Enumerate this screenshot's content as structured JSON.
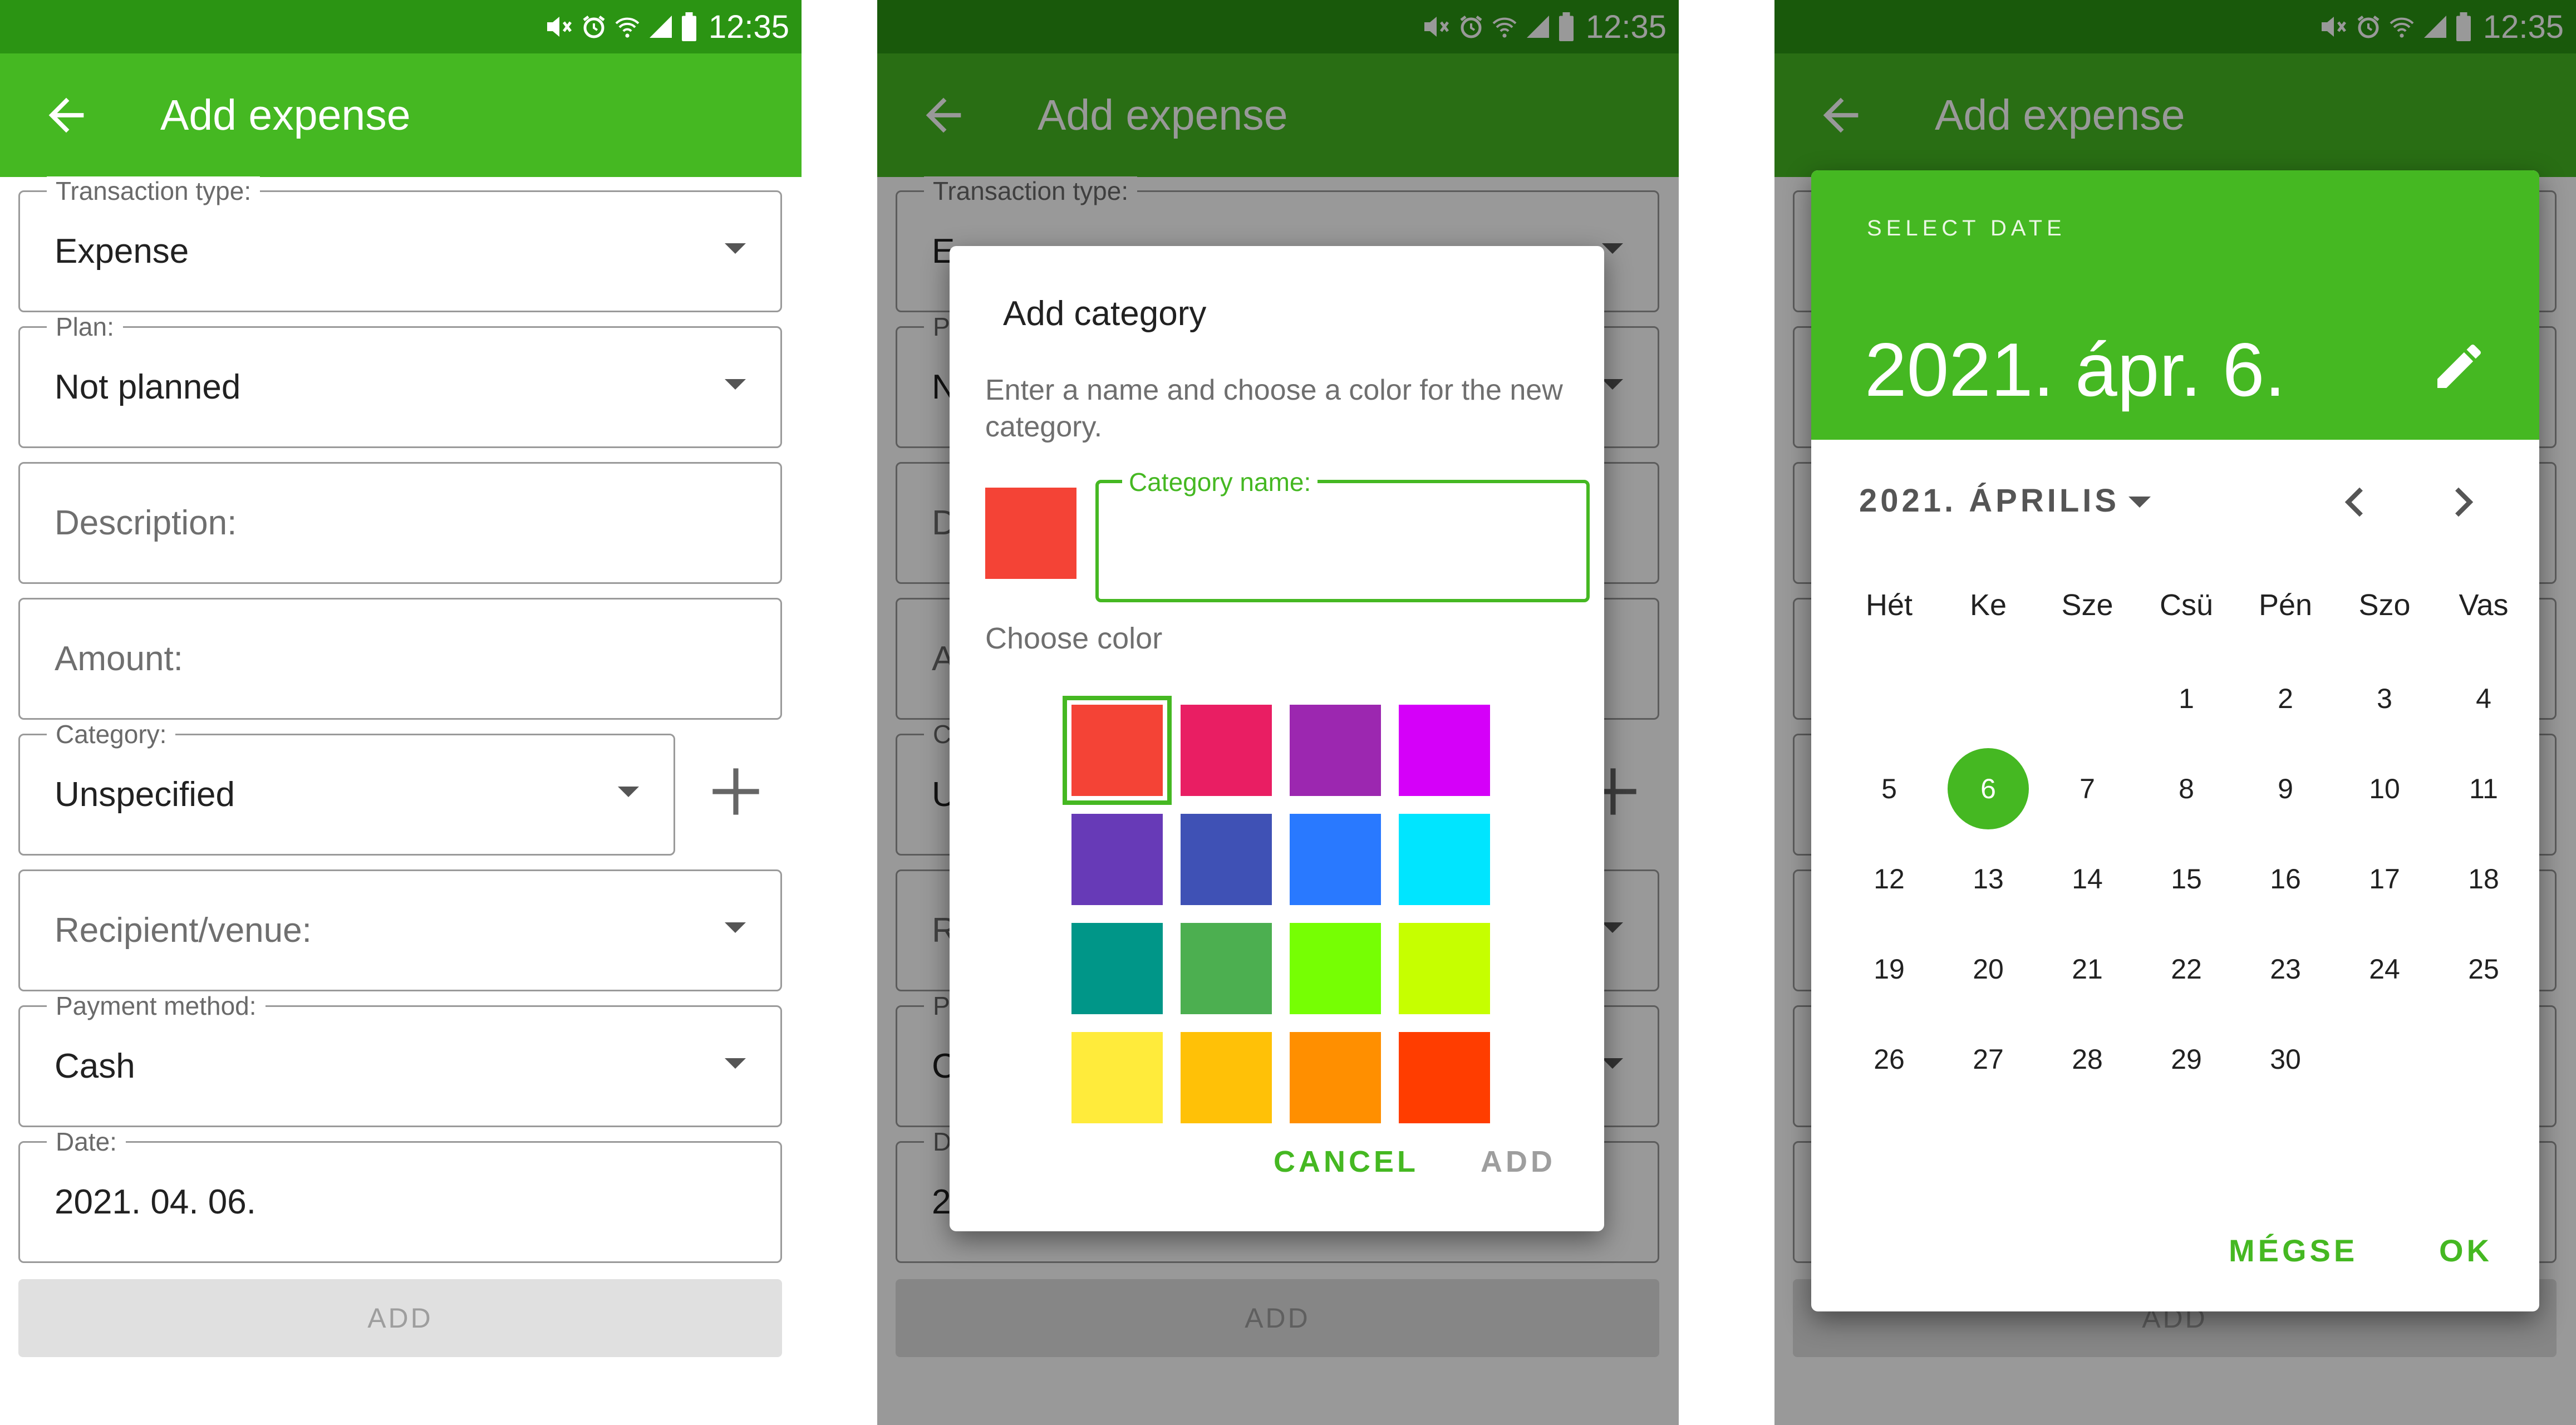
{
  "status_bar": {
    "time": "12:35"
  },
  "screen1": {
    "title": "Add expense",
    "fields": {
      "transaction_type": {
        "label": "Transaction type:",
        "value": "Expense"
      },
      "plan": {
        "label": "Plan:",
        "value": "Not planned"
      },
      "description": {
        "placeholder": "Description:"
      },
      "amount": {
        "placeholder": "Amount:"
      },
      "category": {
        "label": "Category:",
        "value": "Unspecified"
      },
      "recipient": {
        "placeholder": "Recipient/venue:"
      },
      "payment_method": {
        "label": "Payment method:",
        "value": "Cash"
      },
      "date": {
        "label": "Date:",
        "value": "2021. 04. 06."
      }
    },
    "add_button": "ADD"
  },
  "screen2": {
    "title": "Add expense",
    "background_fragments": {
      "transaction_type_label": "Transaction type:",
      "value_initials": [
        "E",
        "N",
        "D",
        "A",
        "U",
        "R",
        "C",
        "2"
      ],
      "label_initials": [
        "P",
        "C",
        "P",
        "D"
      ],
      "add_button": "ADD"
    },
    "dialog": {
      "title": "Add category",
      "message": "Enter a name and choose a color for the new category.",
      "name_field_label": "Category name:",
      "name_field_value": "",
      "choose_color_label": "Choose color",
      "selected_color": "#f44336",
      "colors": [
        "#f44336",
        "#e91e63",
        "#9c27b0",
        "#d500f9",
        "#673ab7",
        "#3f51b5",
        "#2979ff",
        "#00e5ff",
        "#009688",
        "#4caf50",
        "#76ff03",
        "#c6ff00",
        "#ffeb3b",
        "#ffc107",
        "#ff8f00",
        "#ff3d00"
      ],
      "cancel": "CANCEL",
      "add": "ADD"
    }
  },
  "screen3": {
    "title": "Add expense",
    "background_add_button": "ADD",
    "picker": {
      "header_label": "SELECT DATE",
      "selected_date_text": "2021. ápr. 6.",
      "month_label": "2021. ÁPRILIS",
      "weekdays": [
        "Hét",
        "Ke",
        "Sze",
        "Csü",
        "Pén",
        "Szo",
        "Vas"
      ],
      "first_weekday_index": 3,
      "days_in_month": 30,
      "selected_day": 6,
      "cancel": "MÉGSE",
      "ok": "OK"
    }
  },
  "colors": {
    "status_bar": "#2b9413",
    "app_bar": "#45b822",
    "accent": "#45b822",
    "disabled_button": "#e0e0e0"
  },
  "icons": {
    "back": "arrow-left-icon",
    "dropdown": "triangle-down-icon",
    "add": "plus-icon",
    "edit": "pencil-icon",
    "prev": "chevron-left-icon",
    "next": "chevron-right-icon"
  }
}
